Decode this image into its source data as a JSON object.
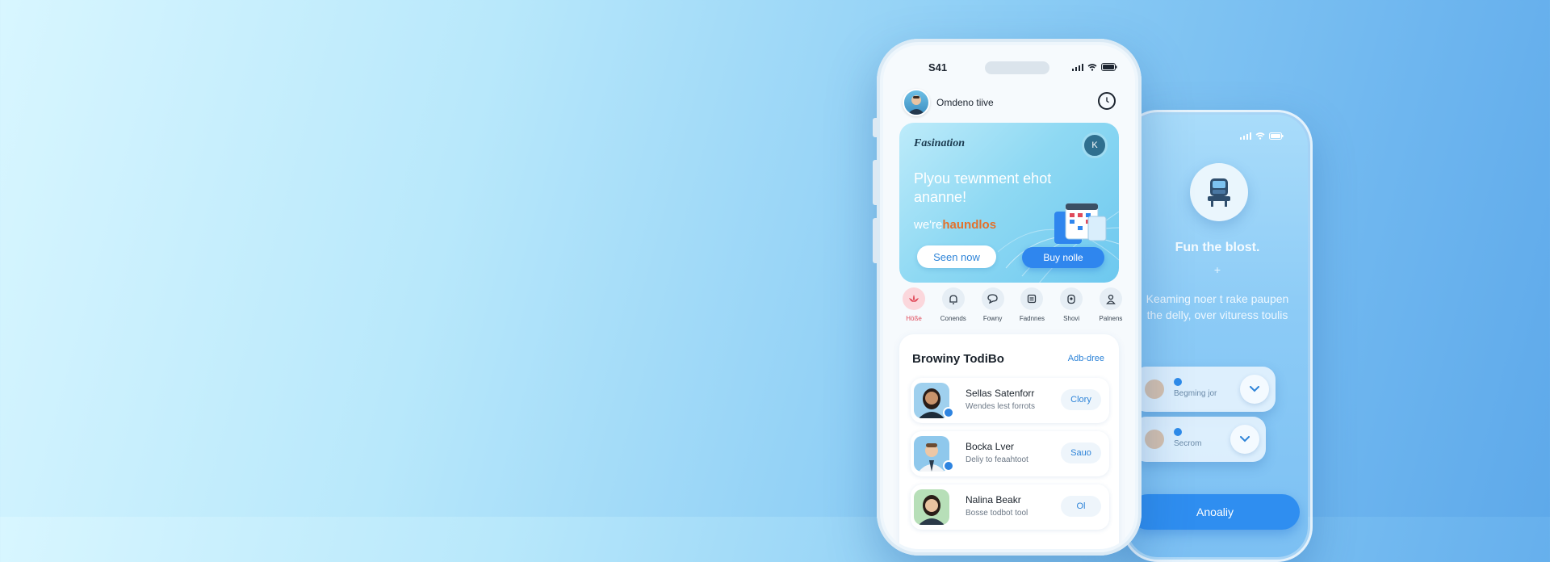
{
  "colors": {
    "accent": "#2f86ee",
    "promo_highlight": "#e3712b",
    "active_category": "#e04a5a"
  },
  "front_phone": {
    "status_time": "S41",
    "profile_name": "Omdeno tiive",
    "clock_icon": "clock-icon",
    "promo": {
      "brand": "Fasination",
      "badge": "K",
      "headline": "Plyou τewnment ehot ananne!",
      "subline_prefix": "we're",
      "subline_highlight": "haundlos",
      "primary_button": "Seen now",
      "secondary_button": "Buy nolle"
    },
    "categories": [
      {
        "label": "Höße",
        "icon": "lotus-icon"
      },
      {
        "label": "Conends",
        "icon": "bell-icon"
      },
      {
        "label": "Fowny",
        "icon": "chat-icon"
      },
      {
        "label": "Fadnnes",
        "icon": "document-icon"
      },
      {
        "label": "Shovi",
        "icon": "location-icon"
      },
      {
        "label": "Palnens",
        "icon": "person-icon"
      }
    ],
    "list": {
      "title": "Browiny TodiBo",
      "link": "Adb-dree",
      "items": [
        {
          "name": "Sellas Satenforr",
          "subtitle": "Wendes lest forrots",
          "action": "Clory"
        },
        {
          "name": "Bocka Lver",
          "subtitle": "Deliy to feaahtoot",
          "action": "Sauo"
        },
        {
          "name": "Nalina Beakr",
          "subtitle": "Bosse todbot tool",
          "action": "Ol"
        }
      ]
    }
  },
  "back_phone": {
    "logo_icon": "train-seat-icon",
    "title": "Fun the blost.",
    "plus": "+",
    "description": "Keaming noer t rake paupen the delly, over vituress toulis",
    "cards": [
      {
        "label": "Begming jor"
      },
      {
        "label": "Secrom"
      }
    ],
    "button": "Anoaliy"
  }
}
